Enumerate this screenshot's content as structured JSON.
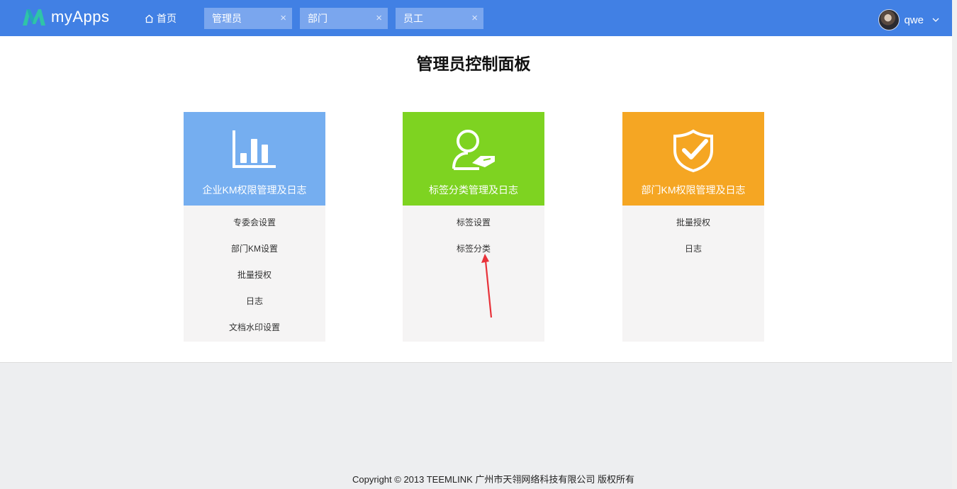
{
  "header": {
    "app_name": "myApps",
    "home_label": "首页",
    "tabs": [
      {
        "label": "管理员",
        "close": "×"
      },
      {
        "label": "部门",
        "close": "×"
      },
      {
        "label": "员工",
        "close": "×"
      }
    ],
    "username": "qwe"
  },
  "page": {
    "title": "管理员控制面板"
  },
  "cards": [
    {
      "title": "企业KM权限管理及日志",
      "color": "#75aef0",
      "icon": "bar-chart-icon",
      "links": [
        "专委会设置",
        "部门KM设置",
        "批量授权",
        "日志",
        "文档水印设置"
      ]
    },
    {
      "title": "标签分类管理及日志",
      "color": "#7ed321",
      "icon": "user-tag-icon",
      "links": [
        "标签设置",
        "标签分类"
      ]
    },
    {
      "title": "部门KM权限管理及日志",
      "color": "#f5a623",
      "icon": "shield-check-icon",
      "links": [
        "批量授权",
        "日志"
      ]
    }
  ],
  "footer": {
    "copyright": "Copyright © 2013 TEEMLINK 广州市天翎网络科技有限公司 版权所有"
  },
  "colors": {
    "topbar": "#4180e4",
    "tab": "#7aa6ee",
    "annotation_arrow": "#e8323a"
  }
}
